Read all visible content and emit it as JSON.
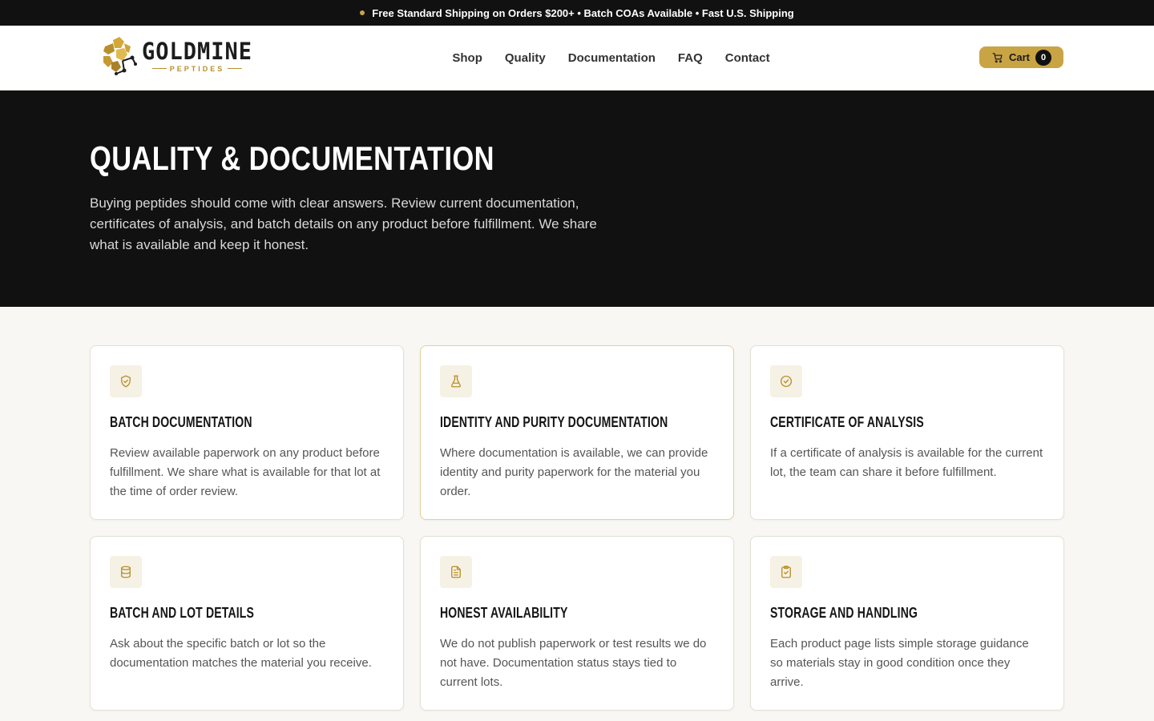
{
  "announcement": {
    "text": "Free Standard Shipping on Orders $200+ • Batch COAs Available • Fast U.S. Shipping",
    "dot_color": "#c9a445"
  },
  "brand": {
    "name": "GOLDMINE",
    "tagline": "PEPTIDES",
    "accent": "#c9a445"
  },
  "nav": {
    "items": [
      {
        "label": "Shop"
      },
      {
        "label": "Quality"
      },
      {
        "label": "Documentation"
      },
      {
        "label": "FAQ"
      },
      {
        "label": "Contact"
      }
    ]
  },
  "cart": {
    "label": "Cart",
    "count": "0",
    "icon": "cart-icon"
  },
  "hero": {
    "title": "QUALITY & DOCUMENTATION",
    "body": "Buying peptides should come with clear answers. Review current documentation, certificates of analysis, and batch details on any product before fulfillment. We share what is available and keep it honest."
  },
  "cards": [
    {
      "icon": "shield-icon",
      "title": "BATCH DOCUMENTATION",
      "body": "Review available paperwork on any product before fulfillment. We share what is available for that lot at the time of order review."
    },
    {
      "icon": "flask-icon",
      "title": "IDENTITY AND PURITY DOCUMENTATION",
      "body": "Where documentation is available, we can provide identity and purity paperwork for the material you order."
    },
    {
      "icon": "badge-check-icon",
      "title": "CERTIFICATE OF ANALYSIS",
      "body": "If a certificate of analysis is available for the current lot, the team can share it before fulfillment."
    },
    {
      "icon": "database-icon",
      "title": "BATCH AND LOT DETAILS",
      "body": "Ask about the specific batch or lot so the documentation matches the material you receive."
    },
    {
      "icon": "document-icon",
      "title": "HONEST AVAILABILITY",
      "body": "We do not publish paperwork or test results we do not have. Documentation status stays tied to current lots."
    },
    {
      "icon": "clipboard-check-icon",
      "title": "STORAGE AND HANDLING",
      "body": "Each product page lists simple storage guidance so materials stay in good condition once they arrive."
    }
  ]
}
